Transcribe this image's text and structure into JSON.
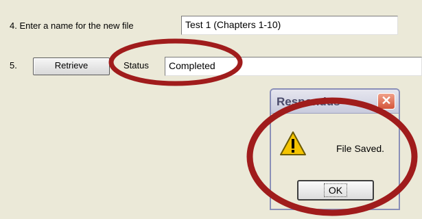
{
  "step4": {
    "label": "4.  Enter a name for the new file",
    "filename_value": "Test 1 (Chapters 1-10)"
  },
  "step5": {
    "label": "5.",
    "retrieve_label": "Retrieve",
    "status_label": "Status",
    "status_value": "Completed"
  },
  "dialog": {
    "title": "Respondus",
    "close_glyph": "✕",
    "icon": "warning-icon",
    "message": "File Saved.",
    "ok_label": "OK"
  },
  "colors": {
    "background": "#ebe9d8",
    "annotation_circle": "#a01c1c",
    "warning_yellow": "#f5c400"
  }
}
